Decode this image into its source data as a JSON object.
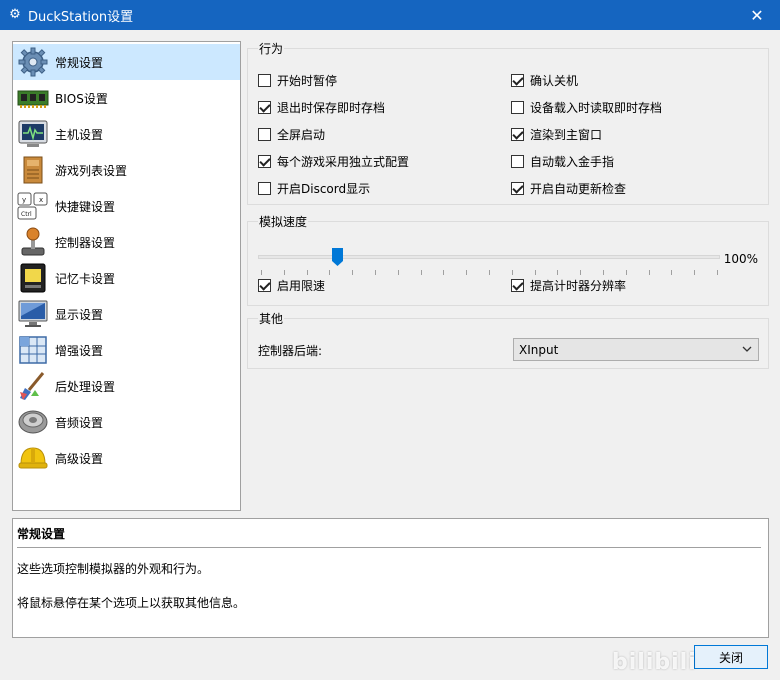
{
  "window": {
    "title": "DuckStation设置",
    "icon": "gear-icon",
    "close_glyph": "✕"
  },
  "sidebar": {
    "items": [
      {
        "label": "常规设置",
        "icon": "gear-icon",
        "selected": true
      },
      {
        "label": "BIOS设置",
        "icon": "memory-chip-icon"
      },
      {
        "label": "主机设置",
        "icon": "monitor-waveform-icon"
      },
      {
        "label": "游戏列表设置",
        "icon": "game-list-icon"
      },
      {
        "label": "快捷键设置",
        "icon": "keyboard-keys-icon"
      },
      {
        "label": "控制器设置",
        "icon": "joystick-icon"
      },
      {
        "label": "记忆卡设置",
        "icon": "memory-card-icon"
      },
      {
        "label": "显示设置",
        "icon": "display-icon"
      },
      {
        "label": "增强设置",
        "icon": "grid-enhance-icon"
      },
      {
        "label": "后处理设置",
        "icon": "paint-brush-icon"
      },
      {
        "label": "音频设置",
        "icon": "speaker-icon"
      },
      {
        "label": "高级设置",
        "icon": "hard-hat-icon"
      }
    ]
  },
  "behavior": {
    "title": "行为",
    "options": [
      {
        "label": "开始时暂停",
        "checked": false
      },
      {
        "label": "确认关机",
        "checked": true
      },
      {
        "label": "退出时保存即时存档",
        "checked": true
      },
      {
        "label": "设备载入时读取即时存档",
        "checked": false
      },
      {
        "label": "全屏启动",
        "checked": false
      },
      {
        "label": "渲染到主窗口",
        "checked": true
      },
      {
        "label": "每个游戏采用独立式配置",
        "checked": true
      },
      {
        "label": "自动载入金手指",
        "checked": false
      },
      {
        "label": "开启Discord显示",
        "checked": false
      },
      {
        "label": "开启自动更新检查",
        "checked": true
      }
    ]
  },
  "speed": {
    "title": "模拟速度",
    "value_label": "100%",
    "slider_fraction": 0.17,
    "options": [
      {
        "label": "启用限速",
        "checked": true
      },
      {
        "label": "提高计时器分辨率",
        "checked": true
      }
    ]
  },
  "other": {
    "title": "其他",
    "backend_label": "控制器后端:",
    "backend_value": "XInput"
  },
  "description": {
    "title": "常规设置",
    "line1": "这些选项控制模拟器的外观和行为。",
    "line2": "将鼠标悬停在某个选项上以获取其他信息。"
  },
  "footer": {
    "close_label": "关闭",
    "watermark": "bilibili"
  },
  "colors": {
    "titlebar": "#1565c0",
    "selected_item": "#cce8ff",
    "slider_thumb": "#0078d7"
  }
}
